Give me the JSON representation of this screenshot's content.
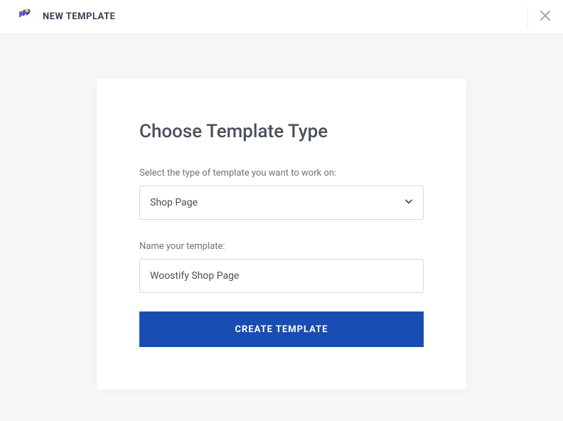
{
  "header": {
    "title": "NEW TEMPLATE"
  },
  "modal": {
    "title": "Choose Template Type",
    "select_label": "Select the type of template you want to work on:",
    "select_value": "Shop Page",
    "name_label": "Name your template:",
    "name_value": "Woostify Shop Page",
    "create_button": "CREATE TEMPLATE"
  }
}
